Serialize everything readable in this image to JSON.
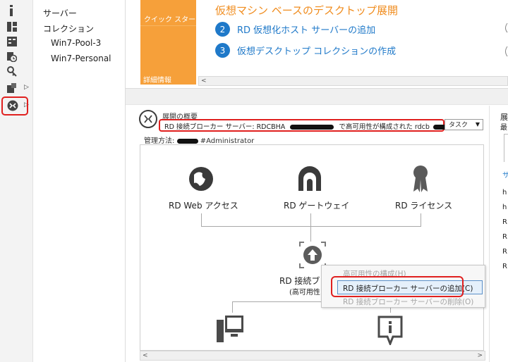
{
  "nav": {
    "items": [
      "サーバー",
      "コレクション",
      "Win7-Pool-3",
      "Win7-Personal"
    ]
  },
  "tiles": {
    "quick_start": "クイック スタート",
    "details": "詳細情報"
  },
  "steps": {
    "title": "仮想マシン ベースのデスクトップ展開",
    "items": [
      {
        "num": "2",
        "label": "RD 仮想化ホスト サーバーの追加"
      },
      {
        "num": "3",
        "label": "仮想デスクトップ コレクションの作成"
      }
    ]
  },
  "overview": {
    "title": "展開の概要",
    "status_pre": "RD 接続ブローカー サーバー: RDCBHA",
    "status_mid": "で高可用性が構成された rdcb",
    "task_label": "タスク",
    "manage_label": "管理方法:",
    "manage_suffix": "#Administrator"
  },
  "diagram": {
    "web_access": "RD Web アクセス",
    "gateway": "RD ゲートウェイ",
    "license": "RD ライセンス",
    "broker": "RD 接続ブ",
    "broker_sub": "(高可用性"
  },
  "context_menu": {
    "items": [
      {
        "label": "高可用性の構成(H)",
        "enabled": false
      },
      {
        "label": "RD 接続ブローカー サーバーの追加(C)",
        "enabled": true
      },
      {
        "label": "RD 接続ブローカー サーバーの削除(O)",
        "enabled": false
      }
    ]
  },
  "right_panel": {
    "head1": "展",
    "head2": "最",
    "link": "サ",
    "rows": [
      "h",
      "h",
      "R",
      "R",
      "R",
      "R"
    ]
  },
  "colors": {
    "accent_orange": "#f6a03a",
    "link_blue": "#1f79c9",
    "highlight_red": "#e0201f"
  },
  "icons": [
    "server-icon",
    "dashboard-icon",
    "local-server-icon",
    "clock-icon",
    "key-icon",
    "file-services-icon",
    "remote-desktop-icon"
  ]
}
